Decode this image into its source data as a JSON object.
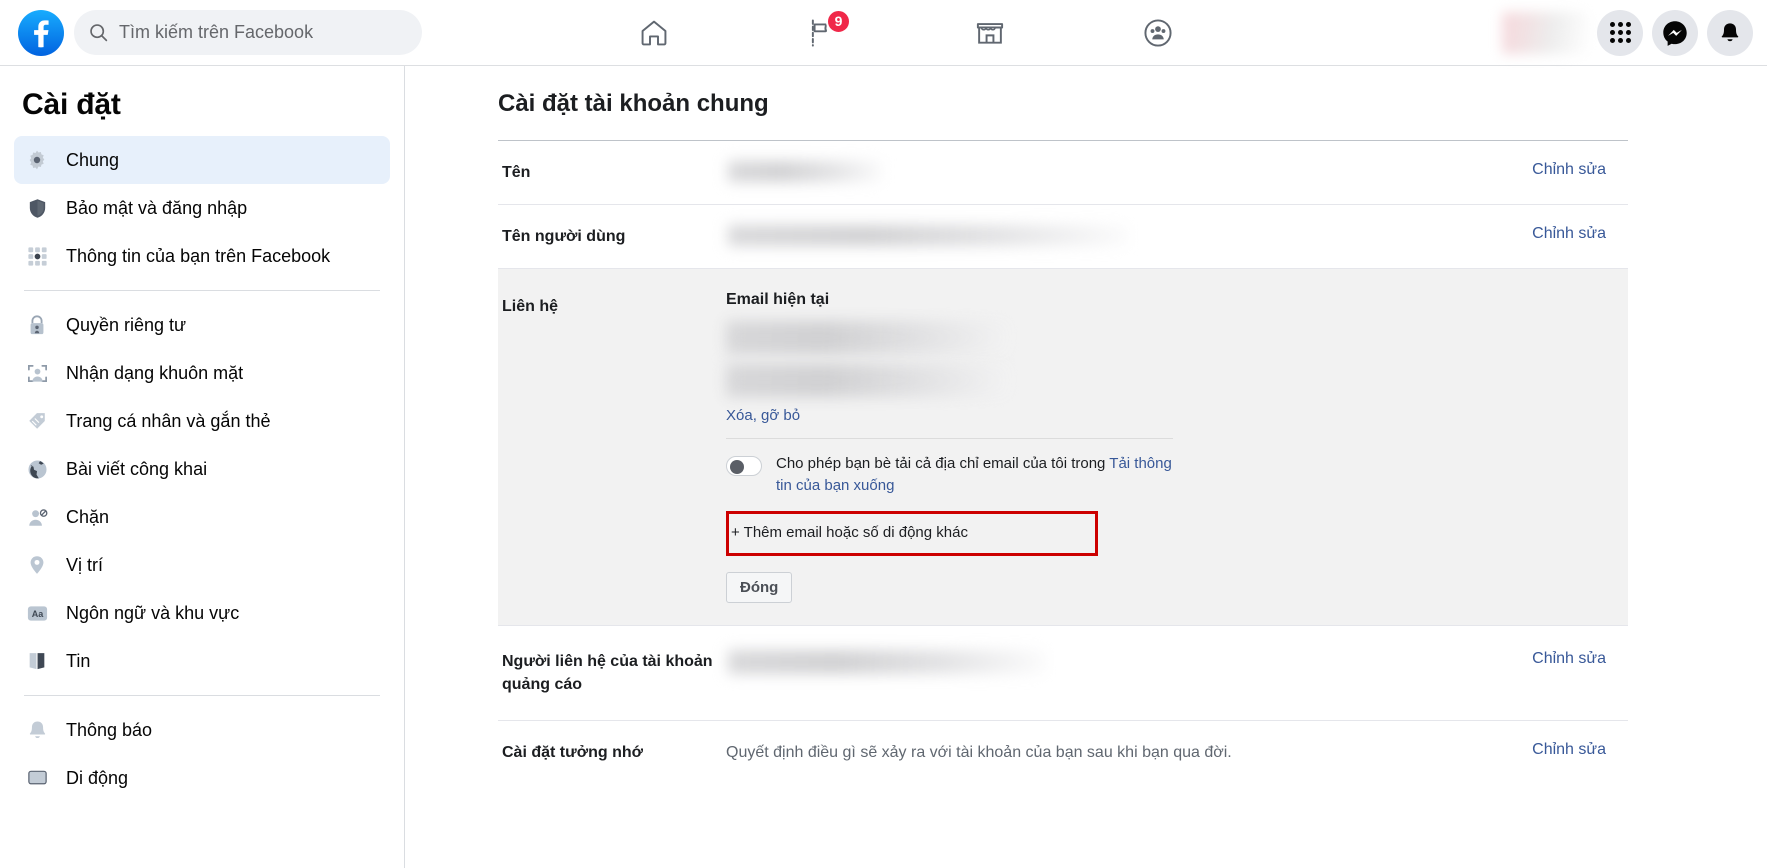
{
  "topbar": {
    "logo_icon": "facebook-logo-icon",
    "search": {
      "placeholder": "Tìm kiếm trên Facebook",
      "icon": "search-icon"
    },
    "nav": [
      {
        "name": "home",
        "icon": "home-icon",
        "badge": ""
      },
      {
        "name": "pages",
        "icon": "flag-icon",
        "badge": "9"
      },
      {
        "name": "marketplace",
        "icon": "store-icon",
        "badge": ""
      },
      {
        "name": "groups",
        "icon": "groups-icon",
        "badge": ""
      }
    ],
    "right": [
      {
        "name": "profile",
        "icon": "profile-avatar"
      },
      {
        "name": "menu",
        "icon": "grid-menu-icon"
      },
      {
        "name": "messenger",
        "icon": "messenger-icon"
      },
      {
        "name": "notifications",
        "icon": "bell-icon"
      }
    ]
  },
  "sidebar": {
    "title": "Cài đặt",
    "groups": [
      [
        {
          "label": "Chung",
          "icon": "gear-icon",
          "active": true
        },
        {
          "label": "Bảo mật và đăng nhập",
          "icon": "shield-icon",
          "active": false
        },
        {
          "label": "Thông tin của bạn trên Facebook",
          "icon": "grid-icon",
          "active": false
        }
      ],
      [
        {
          "label": "Quyền riêng tư",
          "icon": "lock-icon",
          "active": false
        },
        {
          "label": "Nhận dạng khuôn mặt",
          "icon": "face-recognition-icon",
          "active": false
        },
        {
          "label": "Trang cá nhân và gắn thẻ",
          "icon": "tag-icon",
          "active": false
        },
        {
          "label": "Bài viết công khai",
          "icon": "globe-icon",
          "active": false
        },
        {
          "label": "Chặn",
          "icon": "block-user-icon",
          "active": false
        },
        {
          "label": "Vị trí",
          "icon": "location-pin-icon",
          "active": false
        },
        {
          "label": "Ngôn ngữ và khu vực",
          "icon": "language-aa-icon",
          "active": false
        },
        {
          "label": "Tin",
          "icon": "book-icon",
          "active": false
        }
      ],
      [
        {
          "label": "Thông báo",
          "icon": "bell-icon",
          "active": false
        },
        {
          "label": "Di động",
          "icon": "mobile-icon",
          "active": false
        }
      ]
    ]
  },
  "main": {
    "title": "Cài đặt tài khoản chung",
    "edit_label": "Chỉnh sửa",
    "rows": {
      "name": {
        "label": "Tên",
        "value_redacted": true
      },
      "username": {
        "label": "Tên người dùng",
        "value_redacted": true
      },
      "contact": {
        "label": "Liên hệ",
        "subheading": "Email hiện tại",
        "emails_redacted": 2,
        "remove_link": "Xóa, gỡ bỏ",
        "toggle": {
          "state": "off",
          "text_before": "Cho phép bạn bè tải cả địa chỉ email của tôi trong ",
          "link_text": "Tải thông tin của bạn xuống"
        },
        "add_link": "+ Thêm email hoặc số di động khác",
        "close_button": "Đóng",
        "highlight_color": "#cc0000"
      },
      "ad_contact": {
        "label": "Người liên hệ của tài khoản quảng cáo",
        "value_redacted": true
      },
      "memorial": {
        "label": "Cài đặt tưởng nhớ",
        "value": "Quyết định điều gì sẽ xảy ra với tài khoản của bạn sau khi bạn qua đời."
      }
    }
  },
  "colors": {
    "brand_blue": "#1877f2",
    "link_blue": "#385898",
    "badge_red": "#f02849",
    "panel_gray": "#f2f2f2",
    "highlight_red": "#cc0000"
  }
}
